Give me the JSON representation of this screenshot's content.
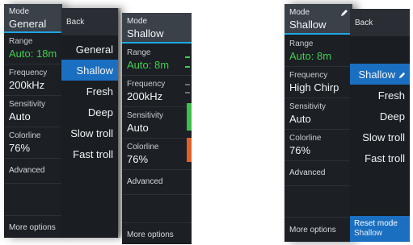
{
  "left": {
    "panelA": {
      "mode_label": "Mode",
      "mode_value": "General",
      "range_label": "Range",
      "range_value": "Auto: 18m",
      "freq_label": "Frequency",
      "freq_value": "200kHz",
      "sens_label": "Sensitivity",
      "sens_value": "Auto",
      "color_label": "Colorline",
      "color_value": "76%",
      "advanced": "Advanced",
      "more": "More options"
    },
    "menu": {
      "back": "Back",
      "items": [
        "General",
        "Shallow",
        "Fresh",
        "Deep",
        "Slow troll",
        "Fast troll"
      ],
      "selected": "Shallow"
    },
    "panelC": {
      "mode_label": "Mode",
      "mode_value": "Shallow",
      "range_label": "Range",
      "range_value": "Auto: 8m",
      "freq_label": "Frequency",
      "freq_value": "200kHz",
      "sens_label": "Sensitivity",
      "sens_value": "Auto",
      "color_label": "Colorline",
      "color_value": "76%",
      "advanced": "Advanced",
      "more": "More options"
    }
  },
  "right": {
    "panelD": {
      "mode_label": "Mode",
      "mode_value": "Shallow",
      "range_label": "Range",
      "range_value": "Auto: 8m",
      "freq_label": "Frequency",
      "freq_value": "High Chirp",
      "sens_label": "Sensitivity",
      "sens_value": "Auto",
      "color_label": "Colorline",
      "color_value": "76%",
      "advanced": "Advanced",
      "more": "More options"
    },
    "menu": {
      "back": "Back",
      "items": [
        "Shallow",
        "Fresh",
        "Deep",
        "Slow troll",
        "Fast troll"
      ],
      "selected": "Shallow",
      "reset_label": "Reset mode",
      "reset_sub": "Shallow"
    }
  },
  "colors": {
    "accent_blue": "#1a6fc0",
    "green_value": "#3fd04d",
    "orange_tick": "#e0602a"
  }
}
